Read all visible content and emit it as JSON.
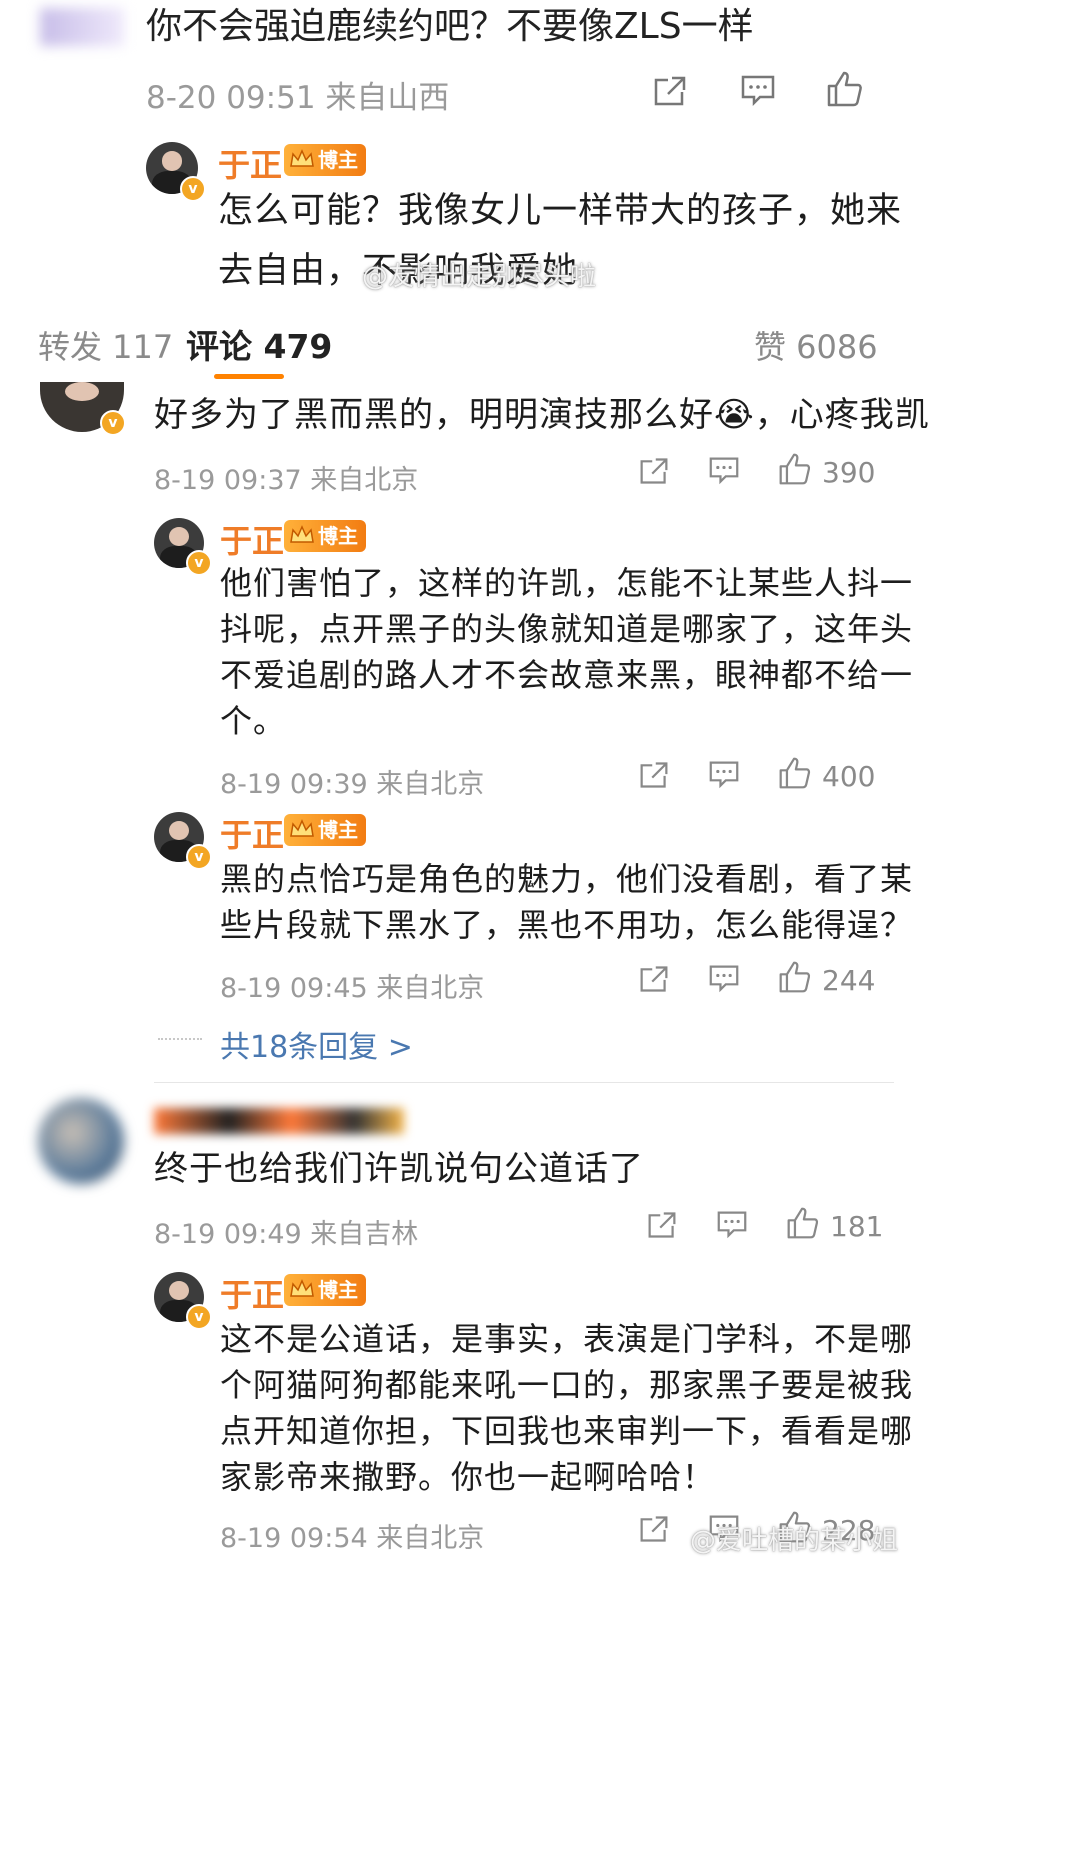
{
  "top_comment": {
    "text": "你不会强迫鹿续约吧？不要像ZLS一样",
    "time_location": "8-20 09:51 来自山西"
  },
  "top_reply": {
    "author": "于正",
    "badge": "博主",
    "text_line1": "怎么可能？我像女儿一样带大的孩子，她来",
    "text_line2": "去自由，不影响我爱她"
  },
  "watermark_1": "@友情出走别尽头啦",
  "tabs": {
    "repost": "转发 117",
    "comment": "评论 479",
    "like": "赞 6086"
  },
  "comment1": {
    "text_before_emoji": "好多为了黑而黑的，明明演技那么好",
    "emoji": "😭",
    "text_after_emoji": "，心疼我凯",
    "time_location": "8-19 09:37 来自北京",
    "likes": "390"
  },
  "reply1": {
    "author": "于正",
    "badge": "博主",
    "lines": [
      "他们害怕了，这样的许凯，怎能不让某些人抖一",
      "抖呢，点开黑子的头像就知道是哪家了，这年头",
      "不爱追剧的路人才不会故意来黑，眼神都不给一",
      "个。"
    ],
    "time_location": "8-19 09:39 来自北京",
    "likes": "400"
  },
  "reply2": {
    "author": "于正",
    "badge": "博主",
    "lines": [
      "黑的点恰巧是角色的魅力，他们没看剧，看了某",
      "些片段就下黑水了，黑也不用功，怎么能得逞？"
    ],
    "time_location": "8-19 09:45 来自北京",
    "likes": "244"
  },
  "more_replies": "共18条回复 >",
  "comment2": {
    "text": "终于也给我们许凯说句公道话了",
    "time_location": "8-19 09:49 来自吉林",
    "likes": "181"
  },
  "reply3": {
    "author": "于正",
    "badge": "博主",
    "lines": [
      "这不是公道话，是事实，表演是门学科，不是哪",
      "个阿猫阿狗都能来吼一口的，那家黑子要是被我",
      "点开知道你担，下回我也来审判一下，看看是哪",
      "家影帝来撒野。你也一起啊哈哈！"
    ],
    "time_location": "8-19 09:54 来自北京",
    "likes": "228"
  },
  "watermark_2": "@爱吐槽的某小姐",
  "colors": {
    "accent": "#ff8200",
    "name": "#ef7c28",
    "link": "#4a78b0",
    "meta": "#9a9a9a"
  }
}
